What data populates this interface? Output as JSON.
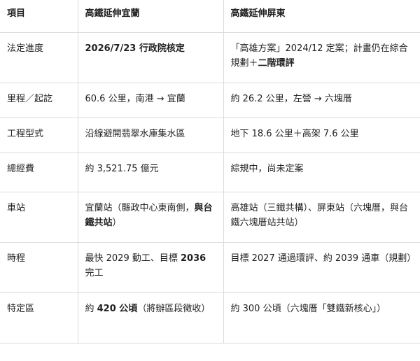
{
  "header": {
    "col1": "項目",
    "col2": "高鐵延伸宜蘭",
    "col3": "高鐵延伸屏東"
  },
  "rows": [
    {
      "label": "法定進度",
      "yilan": [
        {
          "t": "2026/7/23 行政院核定",
          "b": true
        }
      ],
      "pingtung": [
        {
          "t": "「高雄方案」2024/12 定案；計畫仍在綜合規劃＋",
          "b": false
        },
        {
          "t": "二階環評",
          "b": true
        }
      ]
    },
    {
      "label": "里程／起訖",
      "yilan": [
        {
          "t": "60.6 公里，南港 → 宜蘭",
          "b": false
        }
      ],
      "pingtung": [
        {
          "t": "約 26.2 公里，左營 → 六塊厝",
          "b": false
        }
      ]
    },
    {
      "label": "工程型式",
      "yilan": [
        {
          "t": "沿線避開翡翠水庫集水區",
          "b": false
        }
      ],
      "pingtung": [
        {
          "t": "地下 18.6 公里＋高架 7.6 公里",
          "b": false
        }
      ]
    },
    {
      "label": "總經費",
      "yilan": [
        {
          "t": "約 3,521.75 億元",
          "b": false
        }
      ],
      "pingtung": [
        {
          "t": "綜規中，尚未定案",
          "b": false
        }
      ]
    },
    {
      "label": "車站",
      "yilan": [
        {
          "t": "宜蘭站（縣政中心東南側，",
          "b": false
        },
        {
          "t": "與台鐵共站",
          "b": true
        },
        {
          "t": "）",
          "b": false
        }
      ],
      "pingtung": [
        {
          "t": "高雄站（三鐵共構）、屏東站（六塊厝，與台鐵六塊厝站共站）",
          "b": false
        }
      ]
    },
    {
      "label": "時程",
      "yilan": [
        {
          "t": "最快 2029 動工、目標 ",
          "b": false
        },
        {
          "t": "2036",
          "b": true
        },
        {
          "t": " 完工",
          "b": false
        }
      ],
      "pingtung": [
        {
          "t": "目標 2027 通過環評、約 2039 通車（規劃）",
          "b": false
        }
      ]
    },
    {
      "label": "特定區",
      "yilan": [
        {
          "t": "約 ",
          "b": false
        },
        {
          "t": "420 公頃",
          "b": true
        },
        {
          "t": "（將辦區段徵收）",
          "b": false
        }
      ],
      "pingtung": [
        {
          "t": "約 300 公頃（六塊厝「雙鐵新核心」）",
          "b": false
        }
      ]
    }
  ]
}
